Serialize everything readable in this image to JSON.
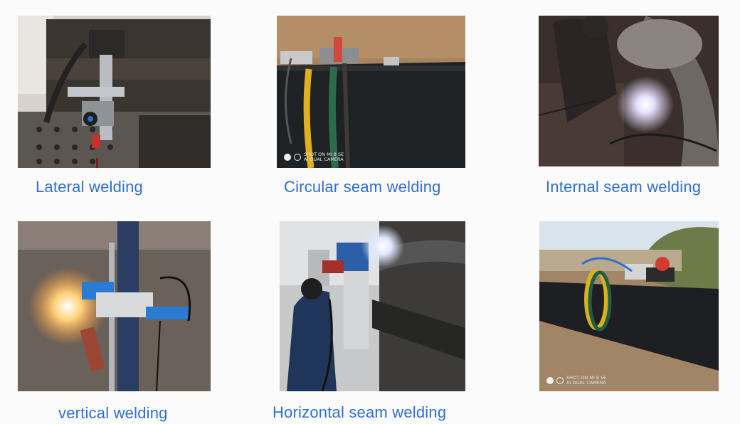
{
  "captions": {
    "lateral": "Lateral welding",
    "circular": "Circular seam welding",
    "internal": "Internal seam welding",
    "vertical": "vertical welding",
    "horizontal": "Horizontal seam welding"
  },
  "watermark": {
    "line1": "SHOT ON MI 8 SE",
    "line2": "AI DUAL CAMERA"
  }
}
